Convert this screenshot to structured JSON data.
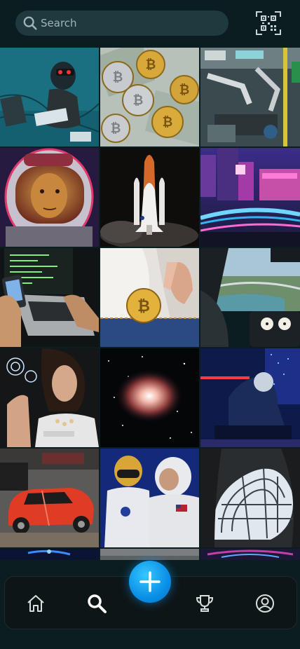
{
  "search": {
    "placeholder": "Search"
  },
  "header": {
    "qr_icon": "qr-code-icon",
    "search_icon": "search-icon"
  },
  "grid": {
    "tiles": [
      "hacker-vr-photo",
      "bitcoin-coins-photo",
      "factory-robots-photo",
      "astronaut-helmet-photo",
      "space-shuttle-photo",
      "city-night-lights-photo",
      "laptop-code-photo",
      "bitcoin-pocket-photo",
      "cockpit-view-photo",
      "woman-hologram-photo",
      "orion-nebula-photo",
      "neon-robot-photo",
      "red-sports-car-photo",
      "robot-astronaut-photo",
      "glass-dome-photo",
      "partial-photo-1",
      "partial-photo-2",
      "partial-photo-3"
    ]
  },
  "nav": {
    "items": [
      "home-icon",
      "search-icon",
      "trophy-icon",
      "profile-icon"
    ],
    "fab": "plus-icon"
  },
  "colors": {
    "background": "#0b1d20",
    "search_bg": "#1f3a3f",
    "accent": "#0a8fe6",
    "nav_bg": "#0e1516"
  }
}
